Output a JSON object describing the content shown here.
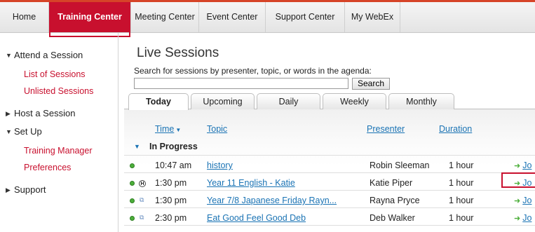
{
  "nav": {
    "tabs": [
      "Home",
      "Training Center",
      "Meeting Center",
      "Event Center",
      "Support Center",
      "My WebEx"
    ],
    "active": "Training Center"
  },
  "sidebar": {
    "attend": "Attend a Session",
    "list_sessions": "List of Sessions",
    "unlisted_sessions": "Unlisted Sessions",
    "host": "Host a Session",
    "setup": "Set Up",
    "training_manager": "Training Manager",
    "preferences": "Preferences",
    "support": "Support"
  },
  "main": {
    "title": "Live Sessions",
    "search_desc": "Search for sessions by presenter, topic, or words in the agenda:",
    "search_value": "",
    "search_button": "Search",
    "tabs": [
      "Today",
      "Upcoming",
      "Daily",
      "Weekly",
      "Monthly"
    ],
    "active_tab": "Today",
    "columns": {
      "time": "Time",
      "topic": "Topic",
      "presenter": "Presenter",
      "duration": "Duration"
    },
    "group": "In Progress",
    "rows": [
      {
        "time": "10:47 am",
        "topic": "history ",
        "presenter": "Robin Sleeman",
        "duration": "1 hour",
        "join": "Jo",
        "icon": ""
      },
      {
        "time": "1:30 pm",
        "topic": "Year 11 English - Katie",
        "presenter": "Katie Piper",
        "duration": "1 hour",
        "join": "Jo",
        "icon": "H"
      },
      {
        "time": "1:30 pm",
        "topic": "Year 7/8 Japanese Friday Rayn...",
        "presenter": "Rayna Pryce",
        "duration": "1 hour",
        "join": "Jo",
        "icon": "s"
      },
      {
        "time": "2:30 pm",
        "topic": "Eat Good Feel Good Deb",
        "presenter": "Deb Walker",
        "duration": "1 hour",
        "join": "Jo",
        "icon": "s"
      }
    ]
  },
  "colors": {
    "accent": "#c8102e",
    "link": "#1a73b4",
    "status_green": "#4caf3a"
  }
}
